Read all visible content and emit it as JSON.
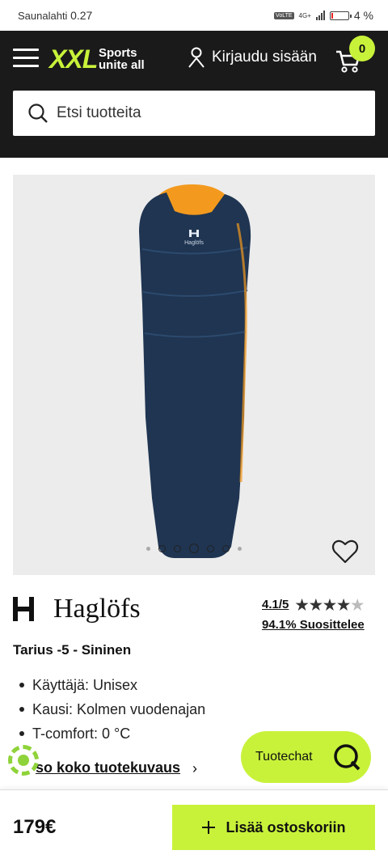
{
  "statusbar": {
    "carrier": "Saunalahti",
    "speed": "0.27",
    "volte": "VoLTE",
    "network": "4G+",
    "battery": "4 %"
  },
  "header": {
    "logo": "XXL",
    "tagline_1": "Sports",
    "tagline_2": "unite all",
    "login_label": "Kirjaudu sisään",
    "cart_count": "0",
    "search_placeholder": "Etsi tuotteita"
  },
  "gallery": {
    "image_count": 7,
    "active_index": 3,
    "product_logo": "Haglöfs"
  },
  "product": {
    "brand": "Haglöfs",
    "rating_score": "4.1/5",
    "rating_stars": 4,
    "rating_max": 5,
    "recommend": "94.1% Suosittelee",
    "title": "Tarius -5 - Sininen",
    "specs": [
      "Käyttäjä: Unisex",
      "Kausi: Kolmen vuodenajan",
      "T-comfort: 0 °C"
    ],
    "description_link": "so koko tuotekuvaus",
    "description_chevron": "›"
  },
  "chat": {
    "label": "Tuotechat"
  },
  "purchase": {
    "price": "179€",
    "add_to_cart": "Lisää ostoskoriin"
  },
  "colors": {
    "accent": "#c8f23a",
    "header_bg": "#1a1a1a",
    "bag_blue": "#1f3552",
    "bag_orange": "#f39a1e"
  }
}
